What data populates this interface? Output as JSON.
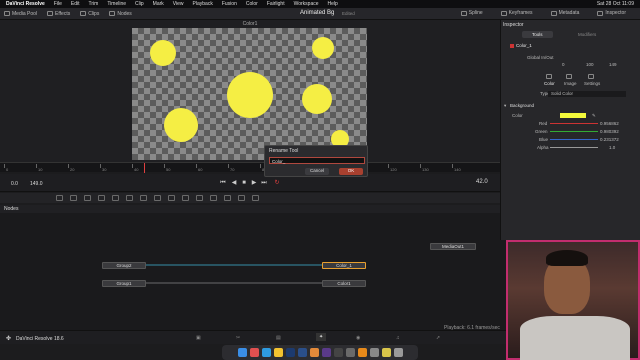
{
  "menubar": {
    "app": "DaVinci Resolve",
    "items": [
      "File",
      "Edit",
      "Trim",
      "Timeline",
      "Clip",
      "Mark",
      "View",
      "Playback",
      "Fusion",
      "Color",
      "Fairlight",
      "Workspace",
      "Help"
    ],
    "clock": "Sat 28 Oct 11:09"
  },
  "toolbar": {
    "media_pool": "Media Pool",
    "effects": "Effects",
    "clips": "Clips",
    "nodes": "Nodes",
    "project_title": "Animated Bg",
    "edited": "Edited",
    "spline": "Spline",
    "keyframes": "Keyframes",
    "metadata": "Metadata",
    "inspector": "Inspector"
  },
  "viewer": {
    "title": "Color1"
  },
  "ruler_labels": [
    "0",
    "10",
    "20",
    "30",
    "40",
    "50",
    "60",
    "70",
    "80",
    "90",
    "100",
    "110",
    "120",
    "130",
    "140"
  ],
  "transport": {
    "current": "0.0",
    "end": "149.0",
    "frame": "42.0"
  },
  "nodes_panel": {
    "title": "Nodes",
    "items": [
      {
        "label": "Group2"
      },
      {
        "label": "Group1"
      },
      {
        "label": "Color_1"
      },
      {
        "label": "Color1"
      },
      {
        "label": "MediaOut1"
      }
    ]
  },
  "dialog": {
    "title": "Rename Tool",
    "value": "Color_",
    "cancel": "Cancel",
    "ok": "OK"
  },
  "inspector": {
    "title": "Inspector",
    "tabs": [
      "Tools",
      "Modifiers"
    ],
    "node_name": "Color_1",
    "global_label": "Global In/Out",
    "global_values": [
      "0",
      "100",
      "149"
    ],
    "subtabs": [
      "Color",
      "Image",
      "Settings"
    ],
    "type_label": "Type",
    "type_value": "Solid Color",
    "section": "Background",
    "color_label": "Color",
    "rows": [
      {
        "label": "Red",
        "value": "0.956862"
      },
      {
        "label": "Green",
        "value": "0.980392"
      },
      {
        "label": "Blue",
        "value": "0.231372"
      },
      {
        "label": "Alpha",
        "value": "1.0"
      }
    ]
  },
  "footer": {
    "app_version": "DaVinci Resolve 18.6",
    "playback": "Playback: 6.1 frames/sec"
  },
  "colors": {
    "swatch": "#f4fa3b",
    "accent": "#e8a030"
  }
}
